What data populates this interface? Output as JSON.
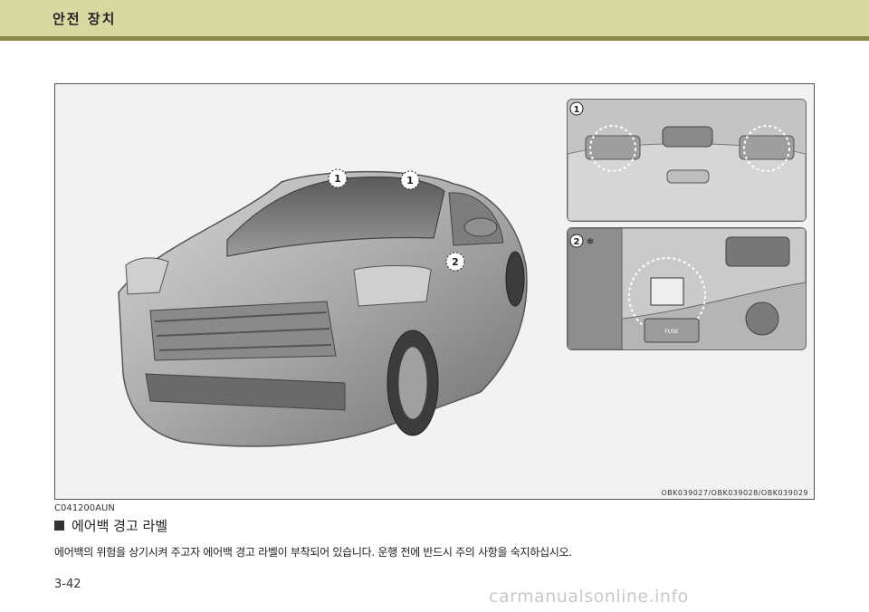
{
  "header": {
    "title": "안전 장치"
  },
  "figure": {
    "callouts": {
      "one": "1",
      "two": "2"
    },
    "inset_label": "FUSE",
    "image_codes": "OBK039027/OBK039028/OBK039029"
  },
  "section": {
    "code": "C041200AUN",
    "heading": "에어백 경고 라벨",
    "body": "에어백의 위험을 상기시켜 주고자 에어백 경고 라벨이 부착되어 있습니다. 운행 전에 반드시 주의 사항을 숙지하십시오."
  },
  "footer": {
    "page_number": "3-42",
    "watermark": "carmanualsonline.info"
  }
}
